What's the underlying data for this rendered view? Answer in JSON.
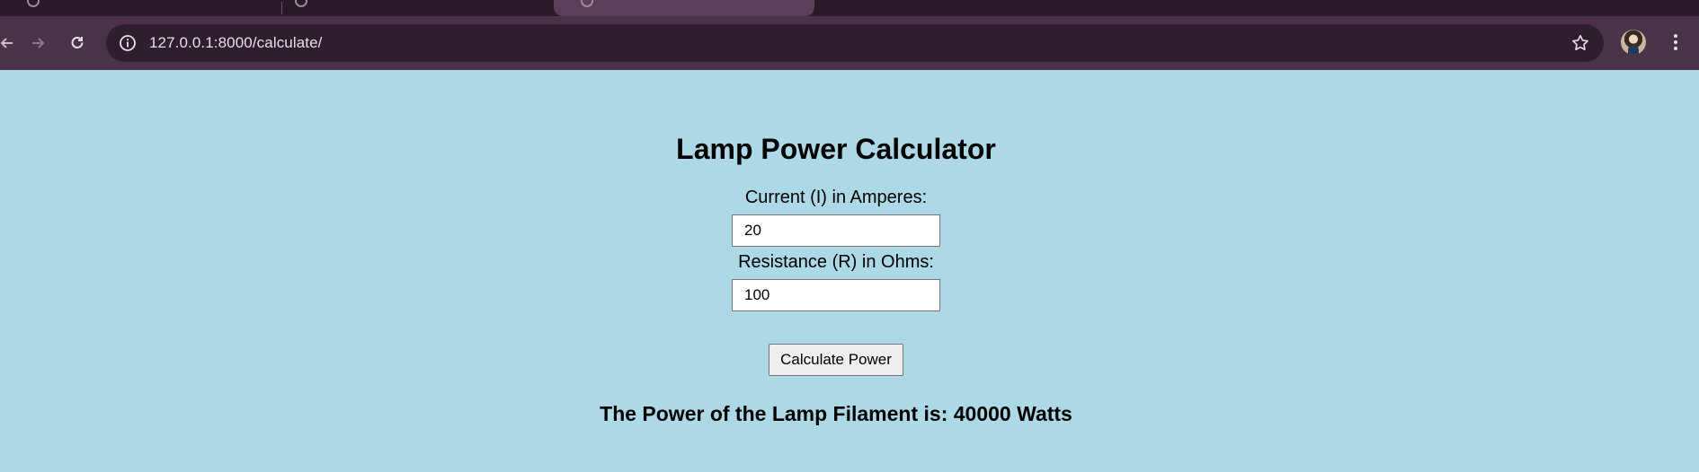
{
  "browser": {
    "url": "127.0.0.1:8000/calculate/",
    "icons": {
      "back": "arrow-left-icon",
      "forward": "arrow-right-icon",
      "reload": "reload-icon",
      "info": "info-icon",
      "bookmark": "star-icon",
      "menu": "kebab-menu-icon"
    }
  },
  "page": {
    "title": "Lamp Power Calculator",
    "current_label": "Current (I) in Amperes:",
    "current_value": "20",
    "resistance_label": "Resistance (R) in Ohms:",
    "resistance_value": "100",
    "button_label": "Calculate Power",
    "result_text": "The Power of the Lamp Filament is: 40000 Watts"
  },
  "colors": {
    "page_background": "#add8e6",
    "toolbar": "#4a3347",
    "omnibox": "#2f1e2d"
  }
}
